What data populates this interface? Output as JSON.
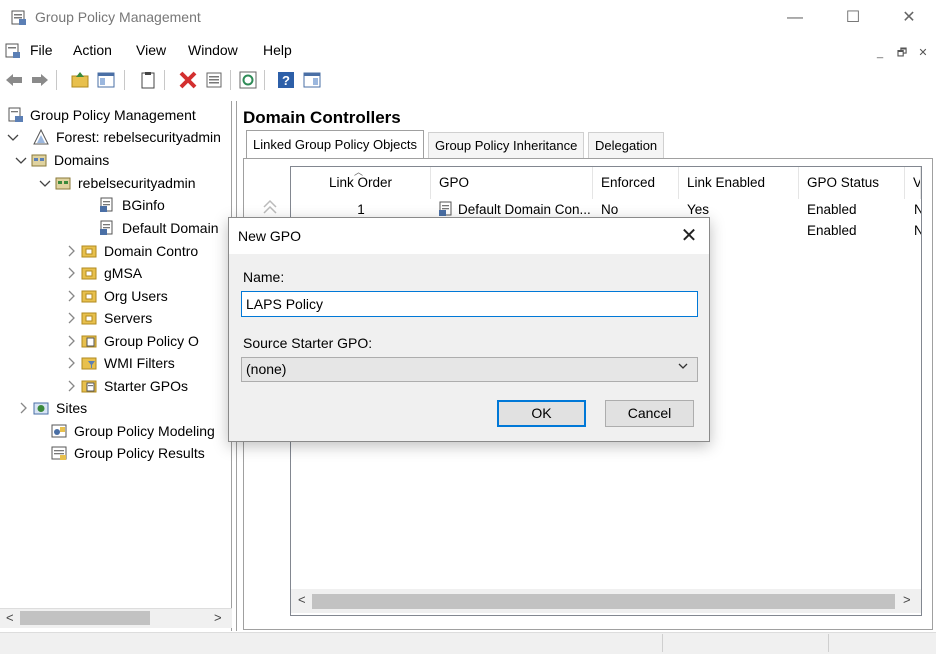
{
  "window": {
    "title": "Group Policy Management",
    "controls": {
      "minimize": "—",
      "maximize": "☐",
      "close": "✕"
    }
  },
  "menubar": {
    "items": [
      "File",
      "Action",
      "View",
      "Window",
      "Help"
    ],
    "mdi_controls": {
      "minimize": "_",
      "restore": "🗗",
      "close": "✕"
    }
  },
  "toolbar": {
    "buttons": [
      "back-arrow-icon",
      "forward-arrow-icon",
      "up-folder-icon",
      "show-hide-tree-icon",
      "clipboard-icon",
      "delete-icon",
      "properties-icon",
      "refresh-icon",
      "help-icon",
      "pane-icon"
    ]
  },
  "tree": {
    "items": [
      {
        "label": "Group Policy Management",
        "icon": "gpm-icon",
        "expander": ""
      },
      {
        "label": "Forest: rebelsecurityadmin",
        "icon": "forest-icon",
        "expander": "v"
      },
      {
        "label": "Domains",
        "icon": "domains-icon",
        "expander": "v"
      },
      {
        "label": "rebelsecurityadmin",
        "icon": "domain-icon",
        "expander": "v"
      },
      {
        "label": "BGinfo",
        "icon": "gpo-link-icon",
        "expander": ""
      },
      {
        "label": "Default Domain",
        "icon": "gpo-link-icon",
        "expander": ""
      },
      {
        "label": "Domain Contro",
        "icon": "ou-icon",
        "expander": ">"
      },
      {
        "label": "gMSA",
        "icon": "ou-icon",
        "expander": ">"
      },
      {
        "label": "Org Users",
        "icon": "ou-icon",
        "expander": ">"
      },
      {
        "label": "Servers",
        "icon": "ou-icon",
        "expander": ">"
      },
      {
        "label": "Group Policy O",
        "icon": "gpo-folder-icon",
        "expander": ">"
      },
      {
        "label": "WMI Filters",
        "icon": "wmi-filter-icon",
        "expander": ">"
      },
      {
        "label": "Starter GPOs",
        "icon": "starter-gpo-icon",
        "expander": ">"
      },
      {
        "label": "Sites",
        "icon": "sites-icon",
        "expander": ">"
      },
      {
        "label": "Group Policy Modeling",
        "icon": "modeling-icon",
        "expander": ""
      },
      {
        "label": "Group Policy Results",
        "icon": "results-icon",
        "expander": ""
      }
    ],
    "scroll_left": "<",
    "scroll_right": ">"
  },
  "right_pane": {
    "title": "Domain Controllers",
    "tabs": [
      "Linked Group Policy Objects",
      "Group Policy Inheritance",
      "Delegation"
    ],
    "active_tab": 0,
    "columns": [
      "Link Order",
      "GPO",
      "Enforced",
      "Link Enabled",
      "GPO Status",
      "V"
    ],
    "rows": [
      {
        "link_order": "1",
        "gpo": "Default Domain Con...",
        "enforced": "No",
        "link_enabled": "Yes",
        "gpo_status": "Enabled",
        "v": "N"
      },
      {
        "link_order": "",
        "gpo": "",
        "enforced": "",
        "link_enabled": "",
        "gpo_status": "Enabled",
        "v": "N"
      }
    ],
    "scroll_left": "<",
    "scroll_right": ">"
  },
  "dialog": {
    "title": "New GPO",
    "close": "✕",
    "name_label": "Name:",
    "name_value": "LAPS Policy",
    "source_label": "Source Starter GPO:",
    "source_value": "(none)",
    "ok_label": "OK",
    "cancel_label": "Cancel"
  },
  "colors": {
    "accent": "#0078d7",
    "gpo_link_icon": "#4a6fa5",
    "ou_icon": "#e8c04d",
    "delete_icon": "#d32f2f"
  }
}
